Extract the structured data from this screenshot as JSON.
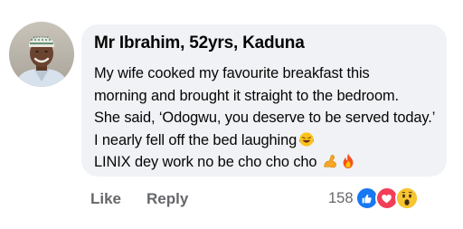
{
  "comment": {
    "author": "Mr Ibrahim, 52yrs, Kaduna",
    "lines": [
      "My wife cooked my favourite breakfast this",
      "morning and brought it straight to the bedroom.",
      "She said, ‘Odogwu, you deserve to be served today.’",
      "I nearly fell off the bed laughing",
      "LINIX dey work no be cho cho cho"
    ],
    "emojis": {
      "line4": [
        "laughing-tears-emoji"
      ],
      "line5": [
        "flexed-biceps-emoji",
        "fire-emoji"
      ]
    }
  },
  "actions": {
    "like_label": "Like",
    "reply_label": "Reply"
  },
  "reactions": {
    "count": "158",
    "types": [
      "like",
      "love",
      "wow"
    ],
    "colors": {
      "like": "#1877f2",
      "love": "#f33e58",
      "wow": "#f7b125"
    }
  }
}
